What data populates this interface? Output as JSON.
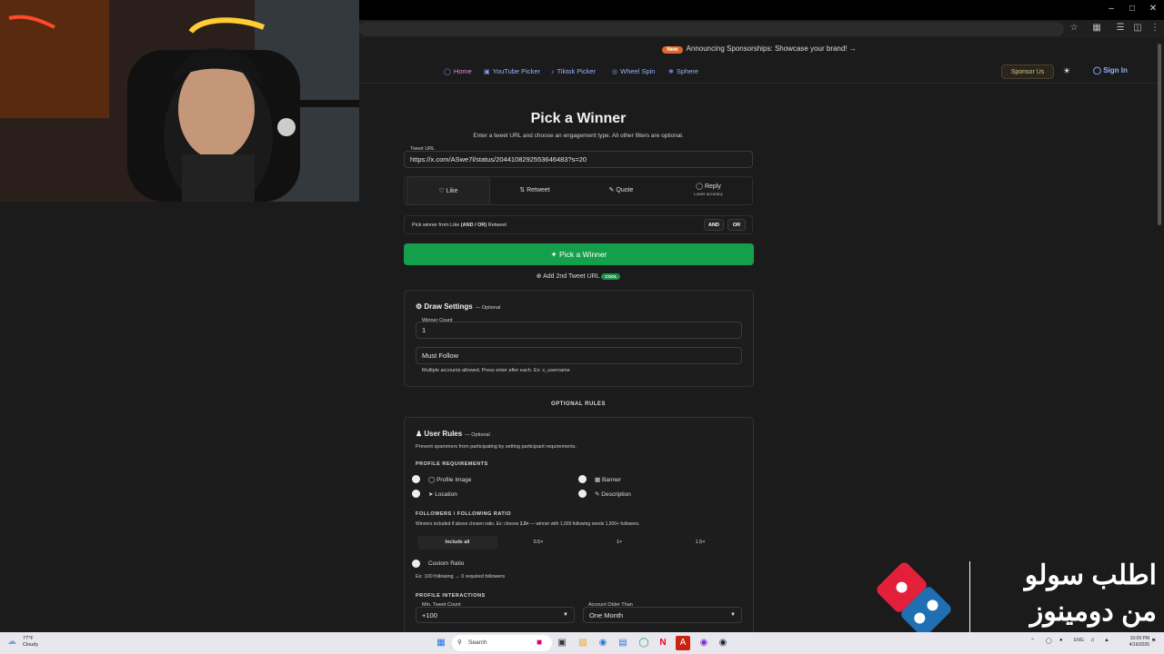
{
  "banner": {
    "badge": "New",
    "text": "Announcing Sponsorships: Showcase your brand! →"
  },
  "nav": {
    "links": [
      {
        "label": "Home",
        "icon": "home-icon"
      },
      {
        "label": "YouTube Picker",
        "icon": "youtube-icon"
      },
      {
        "label": "Tiktok Picker",
        "icon": "tiktok-icon"
      },
      {
        "label": "Wheel Spin",
        "icon": "wheel-icon"
      },
      {
        "label": "Sphere",
        "icon": "sphere-icon"
      }
    ],
    "sponsor": "Sponsor Us",
    "signin": "Sign In"
  },
  "main": {
    "title": "Pick a Winner",
    "subtitle": "Enter a tweet URL and choose an engagement type. All other filters are optional.",
    "tweet_url_label": "Tweet URL",
    "tweet_url_value": "https://x.com/ASwe7l/status/2044108292553646483?s=20",
    "engagements": [
      {
        "label": "Like",
        "icon": "heart-icon"
      },
      {
        "label": "Retweet",
        "icon": "retweet-icon"
      },
      {
        "label": "Quote",
        "icon": "quote-icon"
      },
      {
        "label": "Reply",
        "icon": "reply-icon",
        "note": "Lower accuracy"
      }
    ],
    "andor_text_pre": "Pick winner from Like ",
    "andor_text_bold": "(AND / OR)",
    "andor_text_post": " Retweet",
    "and_label": "AND",
    "or_label": "OR",
    "pick_button": "Pick a Winner",
    "add_second": "Add 2nd Tweet URL",
    "cool_badge": "COOL"
  },
  "draw": {
    "title": "Draw Settings",
    "optional": "— Optional",
    "winner_count_label": "Winner Count",
    "winner_count_value": "1",
    "must_follow_placeholder": "Must Follow",
    "must_follow_hint": "Multiple accounts allowed. Press enter after each. Ex: x_username"
  },
  "optional_rules": "OPTIONAL RULES",
  "user_rules": {
    "title": "User Rules",
    "optional": "— Optional",
    "desc": "Prevent spammers from participating by setting participant requirements.",
    "profile_req_title": "PROFILE REQUIREMENTS",
    "profile_items": [
      {
        "label": "Profile Image",
        "icon": "image-icon"
      },
      {
        "label": "Banner",
        "icon": "banner-icon"
      },
      {
        "label": "Location",
        "icon": "location-icon"
      },
      {
        "label": "Description",
        "icon": "description-icon"
      }
    ],
    "ratio_title": "FOLLOWERS / FOLLOWING RATIO",
    "ratio_desc_pre": "Winners included if above chosen ratio. Ex: choose ",
    "ratio_desc_bold": "1.5×",
    "ratio_desc_post": " — winner with 1,000 following needs 1,500+ followers.",
    "ratio_options": [
      "Include all",
      "0.5×",
      "1×",
      "1.5×"
    ],
    "custom_ratio": "Custom Ratio",
    "custom_ratio_hint": "Ex: 100 following → 0 required followers",
    "interactions_title": "PROFILE INTERACTIONS",
    "min_tweet_label": "Min. Tweet Count",
    "min_tweet_value": "+100",
    "account_older_label": "Account Older Than",
    "account_older_value": "One Month"
  },
  "overlay": {
    "arabic_line1": "اطلب سولو",
    "arabic_line2": "من دومينوز"
  },
  "taskbar": {
    "weather_temp": "77°F",
    "weather_desc": "Cloudy",
    "search": "Search",
    "lang": "ENG",
    "time": "10:09 PM",
    "date": "4/16/2026"
  }
}
